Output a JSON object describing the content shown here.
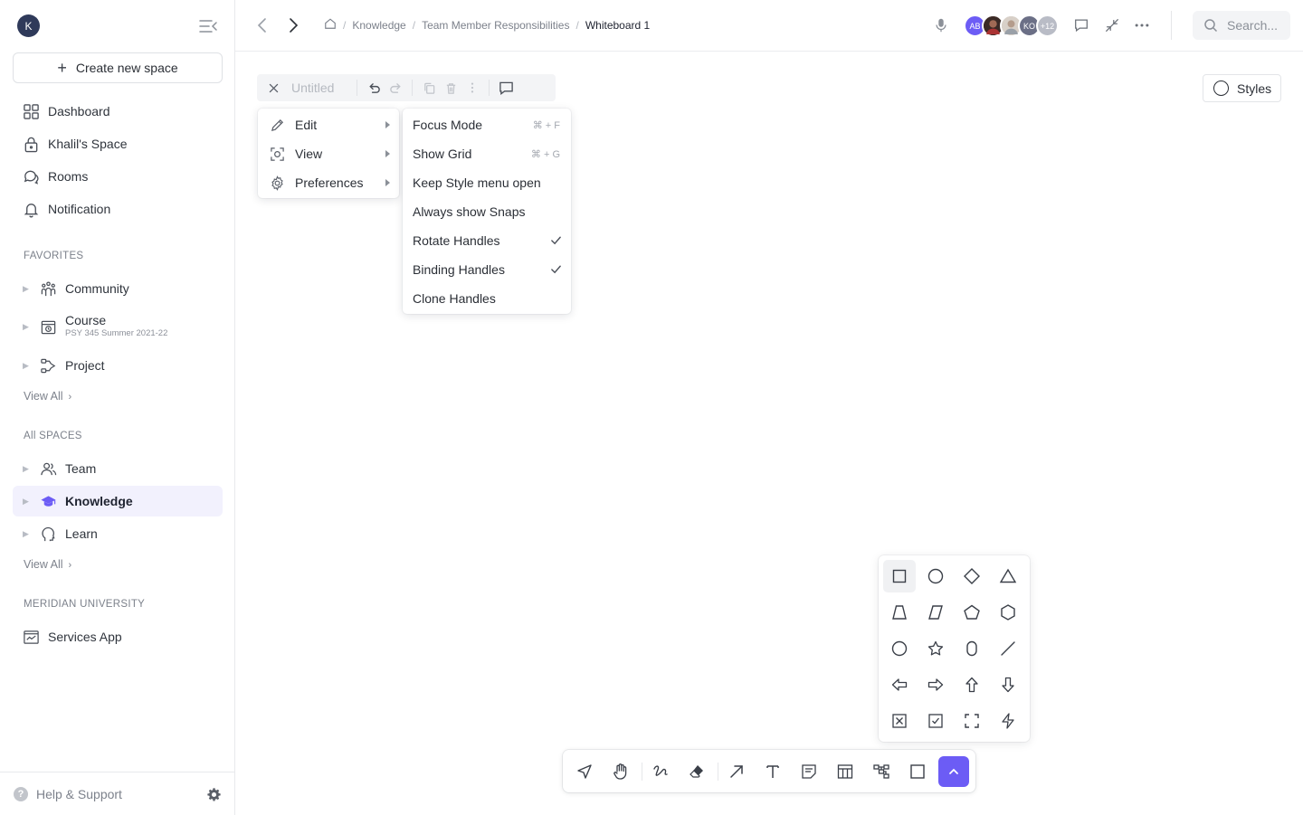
{
  "workspace": {
    "initial": "K"
  },
  "sidebar": {
    "create_label": "Create new space",
    "nav": [
      {
        "label": "Dashboard",
        "icon": "grid-icon"
      },
      {
        "label": "Khalil's Space",
        "icon": "lock-icon"
      },
      {
        "label": "Rooms",
        "icon": "chat-bubbles-icon"
      },
      {
        "label": "Notification",
        "icon": "bell-icon"
      }
    ],
    "favorites_label": "FAVORITES",
    "favorites": [
      {
        "label": "Community",
        "icon": "people-group-icon"
      },
      {
        "label": "Course",
        "sub": "PSY 345 Summer 2021-22",
        "icon": "calendar-course-icon"
      },
      {
        "label": "Project",
        "icon": "project-flow-icon"
      }
    ],
    "favorites_view_all": "View All",
    "all_spaces_label": "All SPACES",
    "spaces": [
      {
        "label": "Team",
        "icon": "team-icon"
      },
      {
        "label": "Knowledge",
        "icon": "graduation-cap-icon",
        "active": true
      },
      {
        "label": "Learn",
        "icon": "head-icon"
      }
    ],
    "spaces_view_all": "View All",
    "org_label": "MERIDIAN UNIVERSITY",
    "org_items": [
      {
        "label": "Services App",
        "icon": "app-chart-icon"
      }
    ],
    "help_label": "Help & Support"
  },
  "topbar": {
    "breadcrumb": [
      "Knowledge",
      "Team Member Responsibilities",
      "Whiteboard 1"
    ],
    "avatars": [
      {
        "initials": "AB",
        "color": "#6c5cf5"
      },
      {
        "initials": "",
        "color": "#7a4a3a"
      },
      {
        "initials": "",
        "color": "#c9c0b8"
      },
      {
        "initials": "KO",
        "color": "#6b6f86"
      },
      {
        "initials": "+12",
        "color": "#b9bcc6"
      }
    ],
    "search_placeholder": "Search..."
  },
  "whiteboard": {
    "title_placeholder": "Untitled",
    "styles_label": "Styles"
  },
  "menu_main": [
    {
      "label": "Edit",
      "icon": "pencil-icon"
    },
    {
      "label": "View",
      "icon": "view-focus-icon"
    },
    {
      "label": "Preferences",
      "icon": "gear-icon"
    }
  ],
  "menu_sub": [
    {
      "label": "Focus Mode",
      "shortcut": "⌘ + F",
      "checked": false
    },
    {
      "label": "Show Grid",
      "shortcut": "⌘ + G",
      "checked": false
    },
    {
      "label": "Keep Style menu open",
      "shortcut": "",
      "checked": false
    },
    {
      "label": "Always show Snaps",
      "shortcut": "",
      "checked": false
    },
    {
      "label": "Rotate Handles",
      "shortcut": "",
      "checked": true
    },
    {
      "label": "Binding Handles",
      "shortcut": "",
      "checked": true
    },
    {
      "label": "Clone Handles",
      "shortcut": "",
      "checked": false
    }
  ],
  "shapes": [
    "rectangle-icon",
    "circle-icon",
    "diamond-icon",
    "triangle-icon",
    "trapezoid-icon",
    "parallelogram-icon",
    "pentagon-icon",
    "hexagon-icon",
    "oval-icon",
    "star-icon",
    "rhombus-oval-icon",
    "line-icon",
    "arrow-left-icon",
    "arrow-right-icon",
    "arrow-up-icon",
    "arrow-down-icon",
    "x-box-icon",
    "check-box-icon",
    "frame-corners-icon",
    "lightning-icon"
  ],
  "tools": [
    "select-icon",
    "hand-icon",
    "draw-icon",
    "eraser-icon",
    "arrow-tool-icon",
    "text-icon",
    "note-icon",
    "table-icon",
    "mindmap-icon",
    "rectangle-tool-icon",
    "more-tools-icon"
  ],
  "colors": {
    "accent": "#6c5cf5",
    "active_bg": "#f2f1fd"
  }
}
